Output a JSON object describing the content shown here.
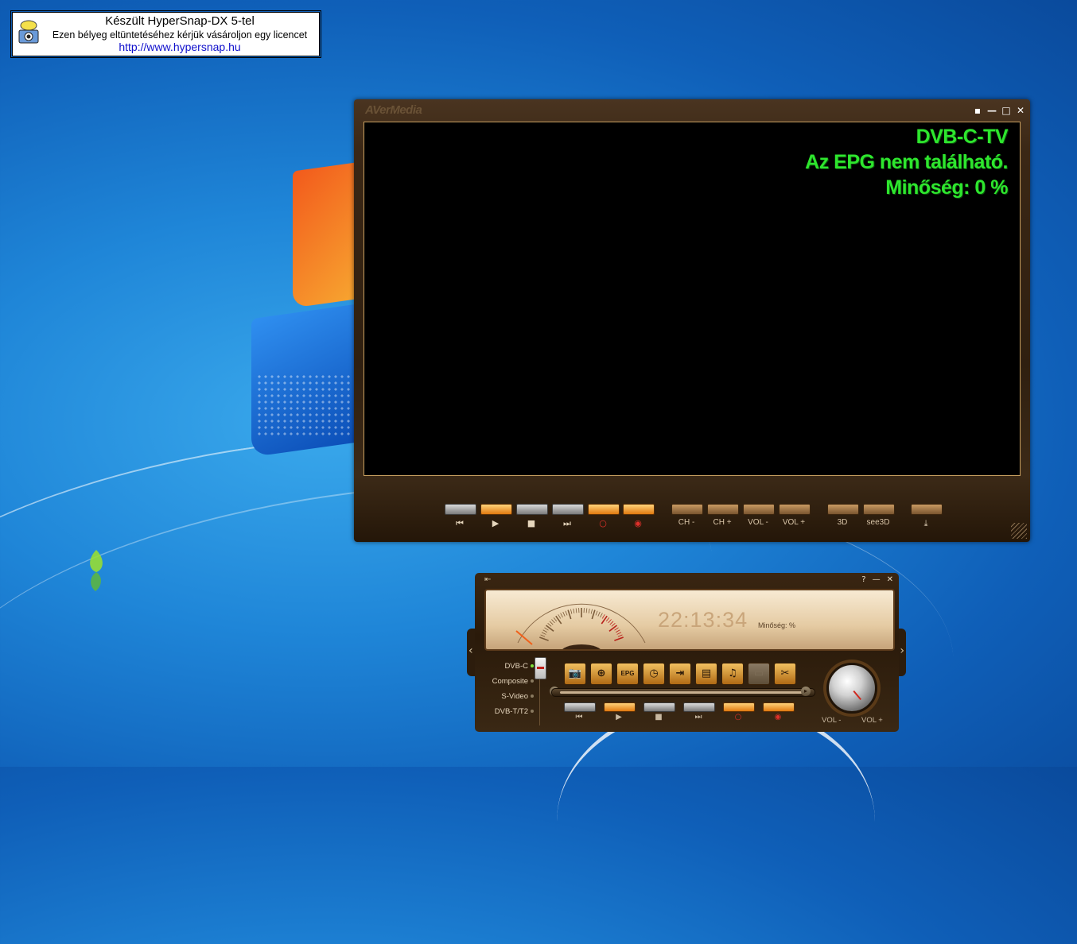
{
  "watermark": {
    "line1": "Készült HyperSnap-DX 5-tel",
    "line2": "Ezen bélyeg eltüntetéséhez kérjük vásároljon egy licencet",
    "url": "http://www.hypersnap.hu"
  },
  "player": {
    "brand": "AVerMedia",
    "window_buttons": [
      "▪",
      "—",
      "□",
      "✕"
    ],
    "osd": {
      "channel": "DVB-C-TV",
      "epg": "Az EPG nem található.",
      "quality": "Minőség: 0 %"
    },
    "controls": [
      {
        "name": "prev-button",
        "icon": "⏮",
        "label": "",
        "style": "gray"
      },
      {
        "name": "play-button",
        "icon": "▶",
        "label": "",
        "style": "orange"
      },
      {
        "name": "stop-button",
        "icon": "■",
        "label": "",
        "style": "gray"
      },
      {
        "name": "next-button",
        "icon": "⏭",
        "label": "",
        "style": "gray"
      },
      {
        "name": "record-button",
        "icon": "○",
        "label": "",
        "style": "orange",
        "red": true
      },
      {
        "name": "timeshift-button",
        "icon": "◉",
        "label": "",
        "style": "orange",
        "red": true
      },
      {
        "name": "ch-minus-button",
        "icon": "",
        "label": "CH -",
        "style": "brown"
      },
      {
        "name": "ch-plus-button",
        "icon": "",
        "label": "CH +",
        "style": "brown"
      },
      {
        "name": "vol-minus-button",
        "icon": "",
        "label": "VOL -",
        "style": "brown"
      },
      {
        "name": "vol-plus-button",
        "icon": "",
        "label": "VOL +",
        "style": "brown"
      },
      {
        "name": "3d-button",
        "icon": "",
        "label": "3D",
        "style": "brown"
      },
      {
        "name": "see3d-button",
        "icon": "",
        "label": "see3D",
        "style": "brown"
      },
      {
        "name": "download-button",
        "icon": "⤓",
        "label": "",
        "style": "brown"
      }
    ]
  },
  "panel": {
    "top_right": [
      "?",
      "—",
      "✕"
    ],
    "time": "22:13:34",
    "quality": "Minőség: %",
    "sources": [
      {
        "label": "DVB-C",
        "active": true
      },
      {
        "label": "Composite",
        "active": false
      },
      {
        "label": "S-Video",
        "active": false
      },
      {
        "label": "DVB-T/T2",
        "active": false
      }
    ],
    "function_buttons": [
      {
        "name": "snapshot-button",
        "icon": "📷",
        "dim": false
      },
      {
        "name": "web-button",
        "icon": "⊕",
        "dim": false
      },
      {
        "name": "epg-button",
        "icon": "EPG",
        "dim": false
      },
      {
        "name": "schedule-button",
        "icon": "◷",
        "dim": false
      },
      {
        "name": "export-button",
        "icon": "⇥",
        "dim": false
      },
      {
        "name": "teletext-button",
        "icon": "▤",
        "dim": false
      },
      {
        "name": "music-button",
        "icon": "♫",
        "dim": false
      },
      {
        "name": "disabled-button",
        "icon": "▭",
        "dim": true
      },
      {
        "name": "settings-button",
        "icon": "✂",
        "dim": false
      }
    ],
    "media_buttons": [
      {
        "name": "mini-prev-button",
        "icon": "⏮",
        "style": "gray",
        "red": false
      },
      {
        "name": "mini-play-button",
        "icon": "▶",
        "style": "orange",
        "red": false
      },
      {
        "name": "mini-stop-button",
        "icon": "■",
        "style": "gray",
        "red": false
      },
      {
        "name": "mini-next-button",
        "icon": "⏭",
        "style": "gray",
        "red": false
      },
      {
        "name": "mini-record-button",
        "icon": "○",
        "style": "orange",
        "red": true
      },
      {
        "name": "mini-timeshift-button",
        "icon": "◉",
        "style": "orange",
        "red": true
      }
    ],
    "vol_minus": "VOL -",
    "vol_plus": "VOL +"
  }
}
